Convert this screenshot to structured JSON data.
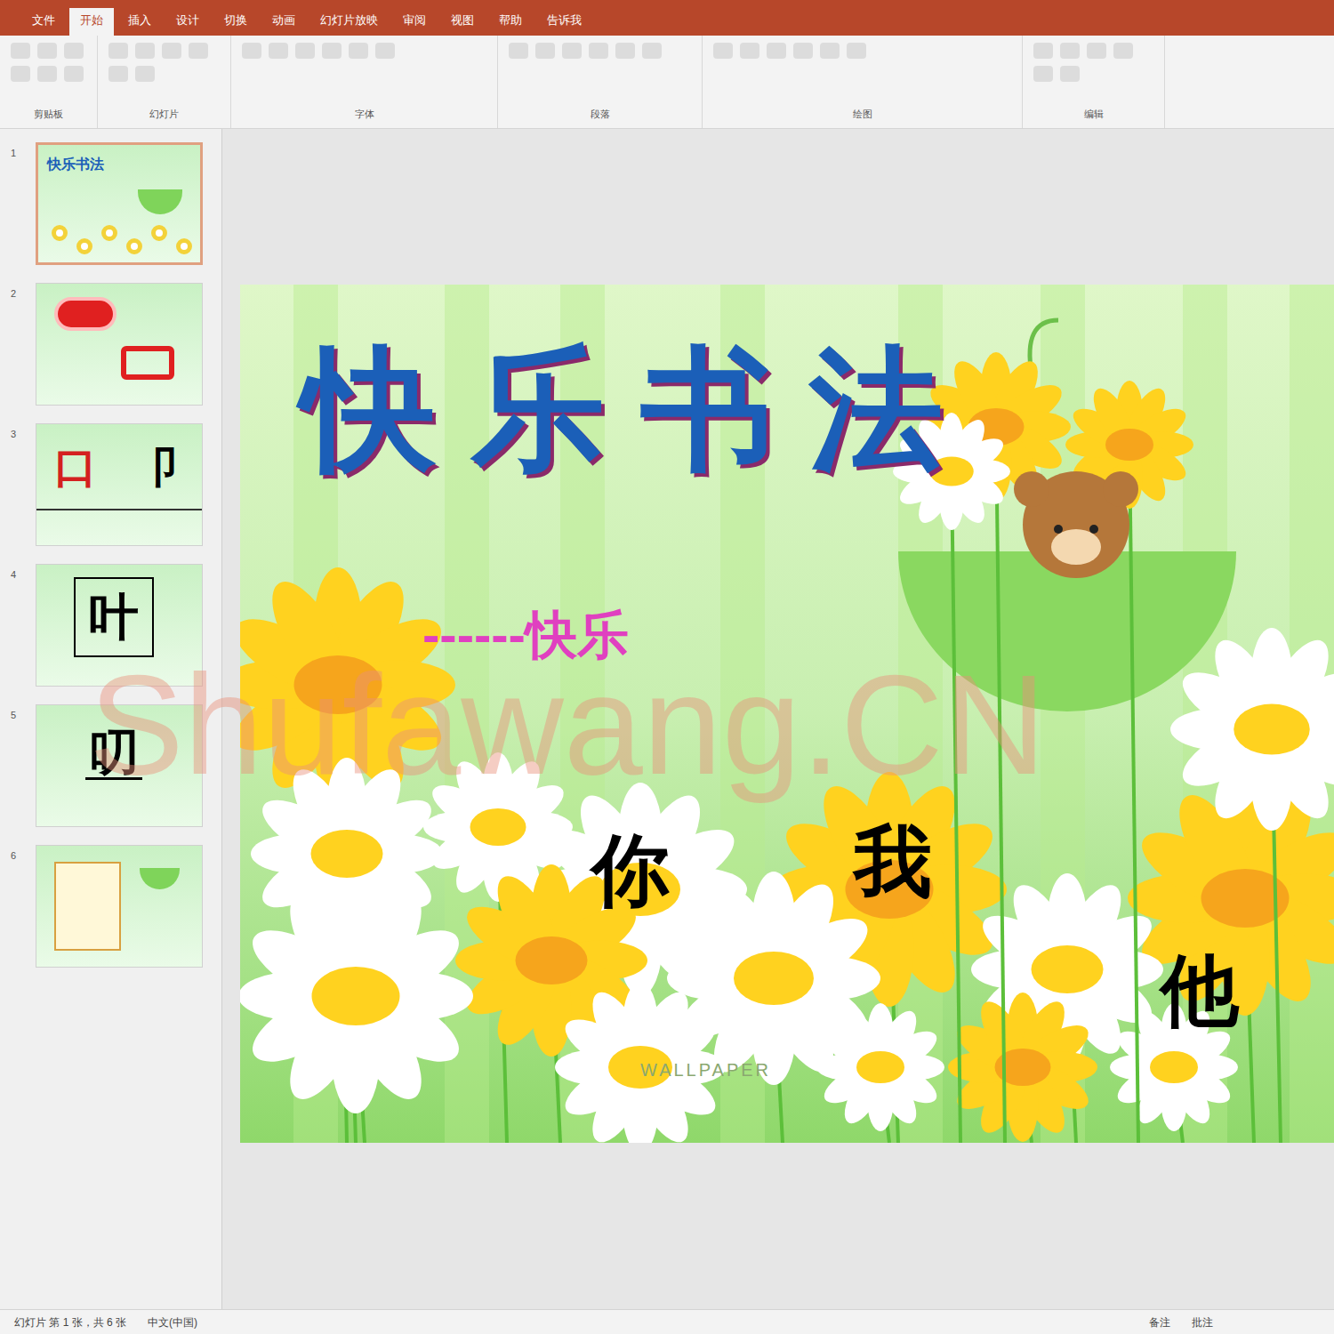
{
  "window": {
    "tabs": [
      {
        "label": "文件",
        "selected": false
      },
      {
        "label": "开始",
        "selected": true
      },
      {
        "label": "插入",
        "selected": false
      },
      {
        "label": "设计",
        "selected": false
      },
      {
        "label": "切换",
        "selected": false
      },
      {
        "label": "动画",
        "selected": false
      },
      {
        "label": "幻灯片放映",
        "selected": false
      },
      {
        "label": "审阅",
        "selected": false
      },
      {
        "label": "视图",
        "selected": false
      },
      {
        "label": "帮助",
        "selected": false
      },
      {
        "label": "告诉我",
        "selected": false
      }
    ]
  },
  "ribbon": {
    "groups": [
      "剪贴板",
      "幻灯片",
      "字体",
      "段落",
      "绘图",
      "编辑"
    ]
  },
  "thumbnails": [
    {
      "number": "1",
      "selected": true,
      "kind": "title",
      "texts": [
        "快乐书法"
      ]
    },
    {
      "number": "2",
      "selected": false,
      "kind": "lips",
      "texts": []
    },
    {
      "number": "3",
      "selected": false,
      "kind": "pair",
      "texts": [
        "口",
        "卩"
      ]
    },
    {
      "number": "4",
      "selected": false,
      "kind": "boxed",
      "texts": [
        "叶"
      ]
    },
    {
      "number": "5",
      "selected": false,
      "kind": "underlined",
      "texts": [
        "叨"
      ]
    },
    {
      "number": "6",
      "selected": false,
      "kind": "menu",
      "texts": []
    }
  ],
  "slide": {
    "title": "快乐书法",
    "subtitle": "------快乐",
    "characters": [
      "你",
      "我",
      "他"
    ],
    "caption": "WALLPAPER"
  },
  "watermark": "Shufawang.CN",
  "status_bar": {
    "left": "幻灯片 第 1 张，共 6 张",
    "language": "中文(中国)",
    "notes": "备注",
    "comments": "批注"
  }
}
